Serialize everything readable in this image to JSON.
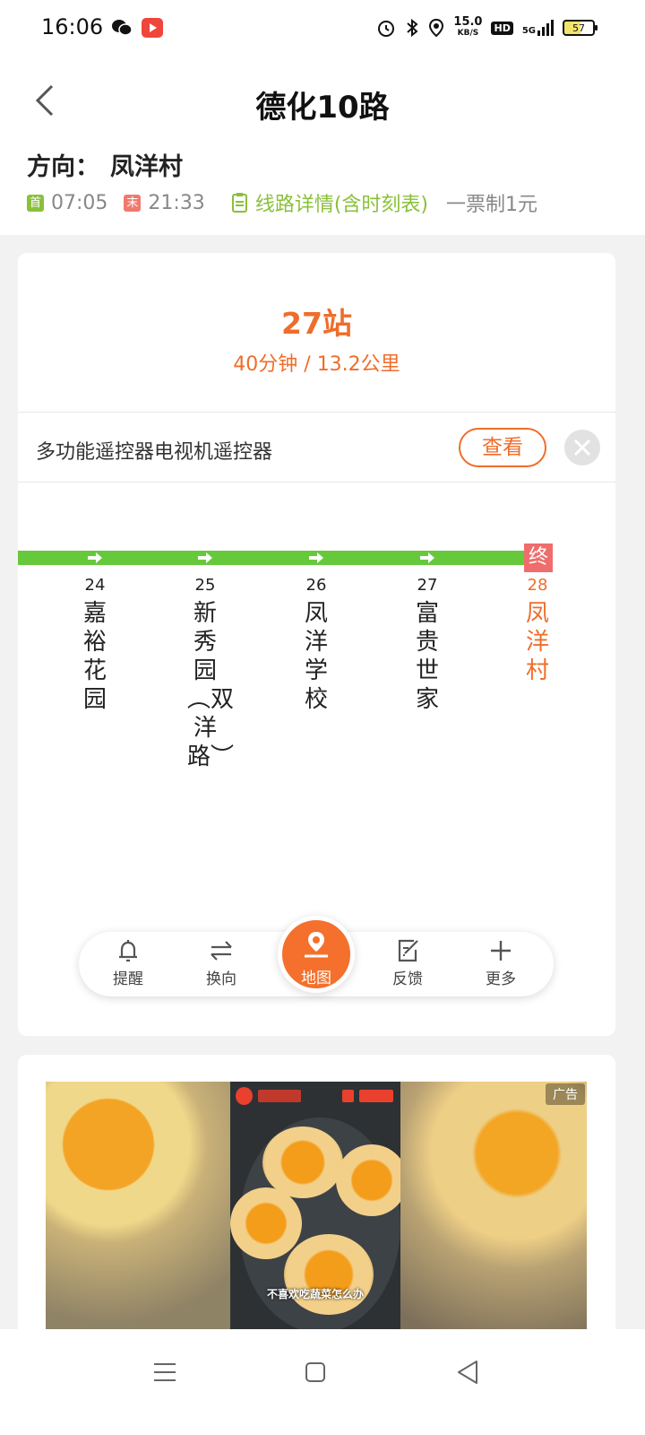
{
  "status_bar": {
    "time": "16:06",
    "net_speed": "15.0",
    "net_unit": "KB/S",
    "hd": "HD",
    "signal": "5G",
    "battery": "57"
  },
  "header": {
    "title": "德化10路",
    "direction_label": "方向：",
    "direction_value": "凤洋村",
    "first_tag": "首",
    "first_time": "07:05",
    "last_tag": "末",
    "last_time": "21:33",
    "detail_link": "线路详情(含时刻表)",
    "fare": "一票制1元"
  },
  "summary": {
    "stations": "27站",
    "time_distance": "40分钟 / 13.2公里"
  },
  "ad_banner": {
    "text": "多功能遥控器电视机遥控器",
    "view_label": "查看"
  },
  "terminal_tag": "终",
  "stops": [
    {
      "num": "24",
      "name": "嘉裕花园"
    },
    {
      "num": "25",
      "name": "新秀园︵双洋路︶"
    },
    {
      "num": "26",
      "name": "凤洋学校"
    },
    {
      "num": "27",
      "name": "富贵世家"
    },
    {
      "num": "28",
      "name": "凤洋村"
    }
  ],
  "tabbar": {
    "remind": "提醒",
    "switch": "换向",
    "map": "地图",
    "feedback": "反馈",
    "more": "更多"
  },
  "ad_card": {
    "caption": "不喜欢吃蔬菜怎么办",
    "label": "广告"
  },
  "colors": {
    "accent": "#ef6d2b",
    "route_green": "#66c93c",
    "link_green": "#8ac03a"
  }
}
